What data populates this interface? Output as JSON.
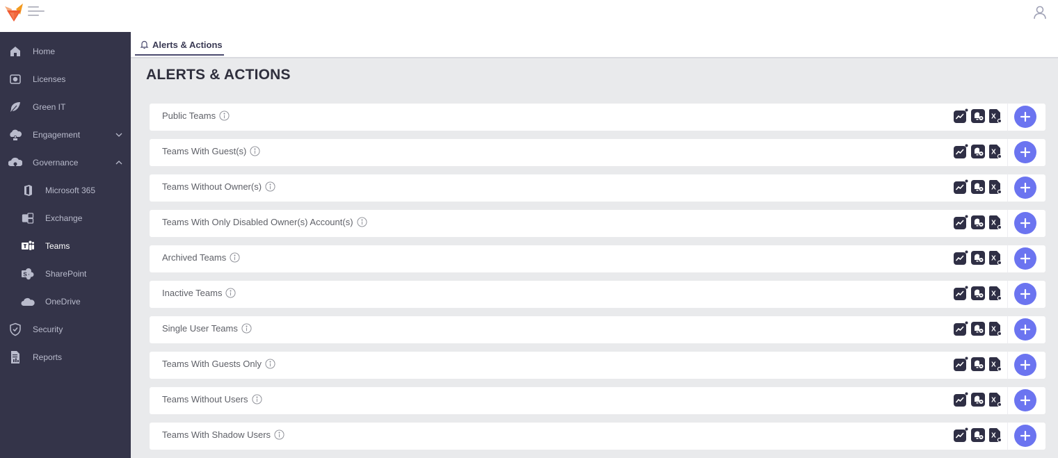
{
  "app": {
    "logo_icon": "fox-logo-icon",
    "menu_icon": "hamburger-menu-icon",
    "user_icon": "user-profile-icon"
  },
  "sidebar": {
    "items": [
      {
        "label": "Home",
        "icon": "home-icon",
        "sub": false,
        "active": false
      },
      {
        "label": "Licenses",
        "icon": "licenses-icon",
        "sub": false,
        "active": false
      },
      {
        "label": "Green IT",
        "icon": "leaf-icon",
        "sub": false,
        "active": false
      },
      {
        "label": "Engagement",
        "icon": "engagement-icon",
        "sub": false,
        "active": false,
        "chevron": "down"
      },
      {
        "label": "Governance",
        "icon": "governance-icon",
        "sub": false,
        "active": false,
        "chevron": "up"
      },
      {
        "label": "Microsoft 365",
        "icon": "office-icon",
        "sub": true,
        "active": false
      },
      {
        "label": "Exchange",
        "icon": "exchange-icon",
        "sub": true,
        "active": false
      },
      {
        "label": "Teams",
        "icon": "teams-icon",
        "sub": true,
        "active": true
      },
      {
        "label": "SharePoint",
        "icon": "sharepoint-icon",
        "sub": true,
        "active": false
      },
      {
        "label": "OneDrive",
        "icon": "onedrive-icon",
        "sub": true,
        "active": false
      },
      {
        "label": "Security",
        "icon": "shield-icon",
        "sub": false,
        "active": false
      },
      {
        "label": "Reports",
        "icon": "reports-icon",
        "sub": false,
        "active": false
      }
    ]
  },
  "tabs": [
    {
      "label": "Alerts & Actions",
      "icon": "bell-icon",
      "active": true
    }
  ],
  "main": {
    "title": "ALERTS & ACTIONS",
    "rows": [
      {
        "label": "Public Teams"
      },
      {
        "label": "Teams With Guest(s)"
      },
      {
        "label": "Teams Without Owner(s)"
      },
      {
        "label": "Teams With Only Disabled Owner(s) Account(s)"
      },
      {
        "label": "Archived Teams"
      },
      {
        "label": "Inactive Teams"
      },
      {
        "label": "Single User Teams"
      },
      {
        "label": "Teams With Guests Only"
      },
      {
        "label": "Teams Without Users"
      },
      {
        "label": "Teams With Shadow Users"
      }
    ],
    "row_actions": [
      "chart-alert-icon",
      "bell-settings-icon",
      "excel-export-icon"
    ],
    "add_icon": "plus-icon"
  },
  "colors": {
    "sidebar_bg": "#343449",
    "accent": "#6b74f0",
    "action_icon_bg": "#2f2f45"
  }
}
